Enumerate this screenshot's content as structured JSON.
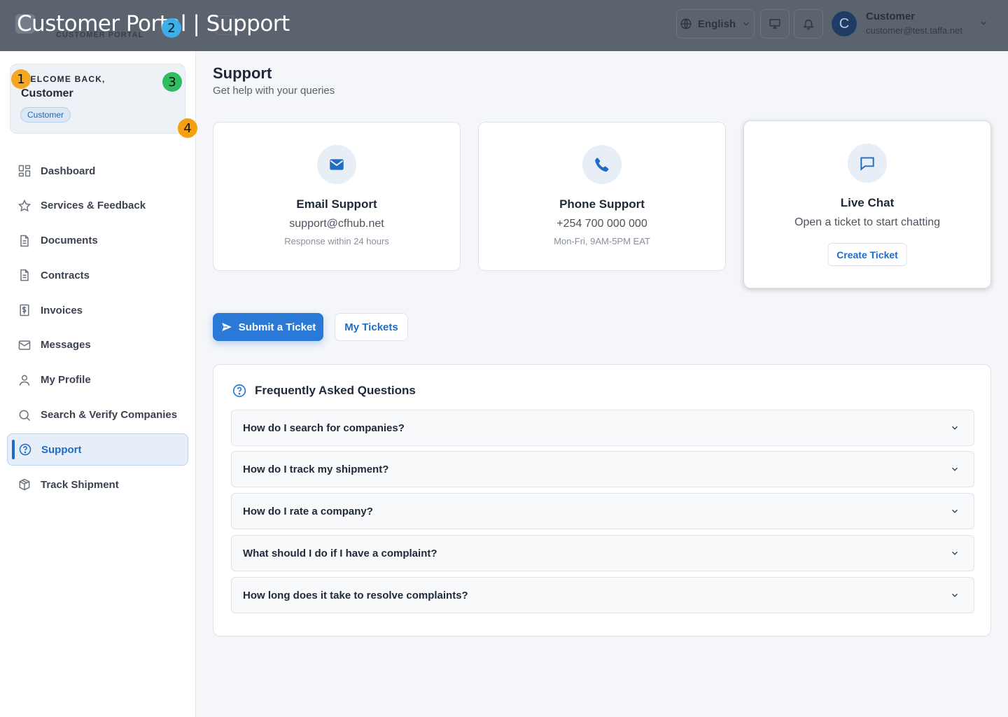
{
  "header": {
    "overlay_title": "Customer Portal | Support",
    "brand_subtitle": "CUSTOMER PORTAL",
    "language": "English",
    "avatar_initial": "C",
    "user_name": "Customer",
    "user_email": "customer@test.taffa.net"
  },
  "welcome": {
    "label": "WELCOME BACK,",
    "name": "Customer",
    "role": "Customer"
  },
  "badges": [
    "1",
    "2",
    "3",
    "4"
  ],
  "sidebar": {
    "items": [
      {
        "label": "Dashboard",
        "icon": "grid-icon"
      },
      {
        "label": "Services & Feedback",
        "icon": "star-icon"
      },
      {
        "label": "Documents",
        "icon": "document-icon"
      },
      {
        "label": "Contracts",
        "icon": "document-icon"
      },
      {
        "label": "Invoices",
        "icon": "dollar-file-icon"
      },
      {
        "label": "Messages",
        "icon": "mail-icon"
      },
      {
        "label": "My Profile",
        "icon": "user-icon"
      },
      {
        "label": "Search & Verify Companies",
        "icon": "search-icon"
      },
      {
        "label": "Support",
        "icon": "help-circle-icon",
        "active": true
      },
      {
        "label": "Track Shipment",
        "icon": "package-icon"
      }
    ]
  },
  "page": {
    "title": "Support",
    "subtitle": "Get help with your queries"
  },
  "cards": {
    "email": {
      "title": "Email Support",
      "value": "support@cfhub.net",
      "note": "Response within 24 hours"
    },
    "phone": {
      "title": "Phone Support",
      "value": "+254 700 000 000",
      "note": "Mon-Fri, 9AM-5PM EAT"
    },
    "chat": {
      "title": "Live Chat",
      "value": "Open a ticket to start chatting",
      "button": "Create Ticket"
    }
  },
  "tabs": {
    "submit": "Submit a Ticket",
    "my_tickets": "My Tickets"
  },
  "faq": {
    "title": "Frequently Asked Questions",
    "items": [
      "How do I search for companies?",
      "How do I track my shipment?",
      "How do I rate a company?",
      "What should I do if I have a complaint?",
      "How long does it take to resolve complaints?"
    ]
  },
  "colors": {
    "primary": "#2a79d6",
    "accent_text": "#1f6cc4",
    "badge_1": "#f5a623",
    "badge_2": "#3bb0e8",
    "badge_3": "#2ebd5f",
    "badge_4": "#f5a00f"
  }
}
